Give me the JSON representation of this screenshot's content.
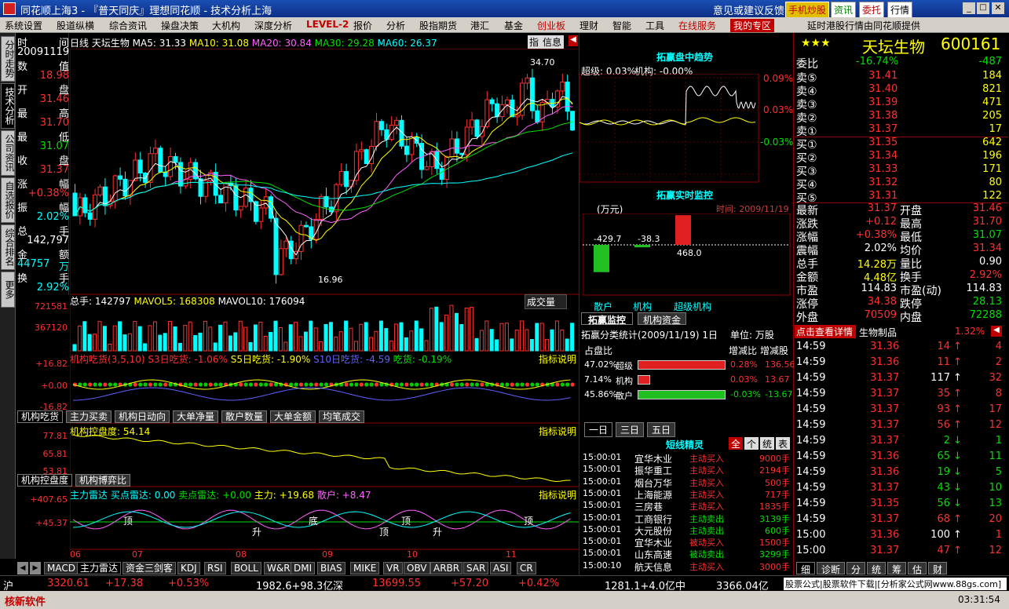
{
  "window": {
    "title": "同花顺上海3 - 『普天同庆』理想同花顺 - 技术分析上海",
    "feedback": "意见或建议反馈",
    "right_btns": [
      "手机炒股",
      "资讯",
      "委托",
      "行情"
    ]
  },
  "menu": [
    "系统设置",
    "股道纵横",
    "综合资讯",
    "操盘决策",
    "大机构",
    "深度分析",
    "LEVEL-2",
    "报价",
    "分析",
    "股指期货",
    "港汇",
    "基金",
    "创业板",
    "理财",
    "智能",
    "工具",
    "在线服务",
    "我的专区"
  ],
  "menu_notice": "延时港股行情由同花顺提供",
  "left_tabs": [
    "分时走势",
    "技术分析",
    "公司资讯",
    "自选报价",
    "综合排名",
    "更多"
  ],
  "info": [
    [
      "时",
      "间"
    ],
    [
      "20091119",
      ""
    ],
    [
      "数",
      "值"
    ],
    [
      "",
      "18.98"
    ],
    [
      "开",
      "盘"
    ],
    [
      "",
      "31.46"
    ],
    [
      "最",
      "高"
    ],
    [
      "",
      "31.70"
    ],
    [
      "最",
      "低"
    ],
    [
      "",
      "31.07"
    ],
    [
      "收",
      "盘"
    ],
    [
      "",
      "31.37"
    ],
    [
      "涨",
      "幅"
    ],
    [
      "",
      "+0.38%"
    ],
    [
      "振",
      "幅"
    ],
    [
      "",
      "2.02%"
    ],
    [
      "总",
      "手"
    ],
    [
      "",
      "142,797"
    ],
    [
      "金",
      "额"
    ],
    [
      "44757",
      "万"
    ],
    [
      "换",
      "手"
    ],
    [
      "",
      "2.92%"
    ]
  ],
  "kline": {
    "header": "日线  天坛生物",
    "ma5": "MA5: 31.33",
    "ma10": "MA10: 31.08",
    "ma20": "MA20: 30.84",
    "ma30": "MA30: 29.28",
    "ma60": "MA60: 26.37",
    "high_label": "34.70",
    "low_label": "16.96",
    "buttons": [
      "指",
      "信息"
    ]
  },
  "volume": {
    "header": "总手: 142797",
    "mavol5": "MAVOL5: 168308",
    "mavol10": "MAVOL10: 176094",
    "selector": "成交量",
    "ticks": [
      "721581",
      "367120"
    ]
  },
  "ind1": {
    "title": "机构吃货(3,5,10)",
    "s3": "S3日吃货: -1.06%",
    "s5": "S5日吃货: -1.90%",
    "s10": "S10日吃货: -4.59",
    "eat": "吃货: -0.19%",
    "explain": "指标说明",
    "ticks": [
      "+16.82",
      "+0.00",
      "-16.82"
    ]
  },
  "ind1_tabs": [
    "机构吃货",
    "主力买卖",
    "机构日动向",
    "大单净量",
    "散户数量",
    "大单金额",
    "均笔成交"
  ],
  "ind2": {
    "title": "机构控盘度: 54.14",
    "explain": "指标说明",
    "ticks": [
      "77.81",
      "65.81",
      "53.81"
    ]
  },
  "ind2_tabs": [
    "机构控盘度",
    "机构博弈比"
  ],
  "ind3": {
    "title": "主力雷达",
    "buy": "买点雷达: 0.00",
    "sell": "卖点雷达: +0.00",
    "main": "主力: +19.68",
    "retail": "散户: +8.47",
    "explain": "指标说明",
    "ticks": [
      "+407.65",
      "+45.37"
    ],
    "marks": [
      "顶",
      "升",
      "底",
      "顶",
      "顶",
      "升",
      "顶"
    ]
  },
  "x_axis": [
    "06",
    "07",
    "08",
    "09",
    "10",
    "11"
  ],
  "bottom_ind_tabs": [
    "MACD",
    "主力雷达",
    "资金三剑客",
    "KDJ",
    "RSI",
    "BOLL",
    "W&R",
    "DMI",
    "BIAS",
    "MIKE",
    "VR",
    "OBV",
    "ARBR",
    "SAR",
    "ASI",
    "CR"
  ],
  "mid": {
    "trend_title": "拓赢盘中趋势",
    "super": "超级: 0.03%",
    "inst": "机构: -0.00%",
    "trend_ticks": [
      "0.09%",
      "0.03%",
      "-0.03%"
    ],
    "rt_title": "拓赢实时监控",
    "unit": "(万元)",
    "time": "时间: 2009/11/19",
    "bar_labels": [
      "-429.7",
      "-38.3",
      "468.0"
    ],
    "bar_names": [
      "散户",
      "机构",
      "超级机构"
    ],
    "tabs": [
      "拓赢监控",
      "机构资金"
    ],
    "stat_title": "拓赢分类统计(2009/11/19) 1日",
    "stat_unit": "单位: 万股",
    "stat_headers": [
      "占盘比",
      "增减比",
      "增减股"
    ],
    "stat_rows": [
      [
        "47.02%",
        "超级",
        "0.28%",
        "136.56"
      ],
      [
        "7.14%",
        "机构",
        "0.03%",
        "13.67"
      ],
      [
        "45.86%",
        "散户",
        "-0.03%",
        "-13.67"
      ]
    ],
    "period_tabs": [
      "一日",
      "三日",
      "五日"
    ],
    "elf_title": "短线精灵",
    "elf_btns": [
      "全",
      "个",
      "统",
      "表"
    ],
    "elf_rows": [
      [
        "15:00:01",
        "宜华木业",
        "主动买入",
        "9000手"
      ],
      [
        "15:00:01",
        "振华重工",
        "主动买入",
        "2194手"
      ],
      [
        "15:00:01",
        "烟台万华",
        "主动买入",
        "500手"
      ],
      [
        "15:00:01",
        "上海能源",
        "主动买入",
        "717手"
      ],
      [
        "15:00:01",
        "三房巷",
        "主动买入",
        "1835手"
      ],
      [
        "15:00:01",
        "工商银行",
        "主动卖出",
        "3139手"
      ],
      [
        "15:00:01",
        "大元股份",
        "主动卖出",
        "600手"
      ],
      [
        "15:00:01",
        "宜华木业",
        "被动买入",
        "1500手"
      ],
      [
        "15:00:01",
        "山东高速",
        "被动卖出",
        "3299手"
      ],
      [
        "15:00:10",
        "航天信息",
        "主动买入",
        "3000手"
      ]
    ]
  },
  "quote": {
    "stars": "★★★",
    "name": "天坛生物",
    "code": "600161",
    "wb": [
      "委比",
      "-16.74%",
      "-487"
    ],
    "asks": [
      [
        "卖⑤",
        "31.41",
        "184"
      ],
      [
        "卖④",
        "31.40",
        "821"
      ],
      [
        "卖③",
        "31.39",
        "471"
      ],
      [
        "卖②",
        "31.38",
        "205"
      ],
      [
        "卖①",
        "31.37",
        "17"
      ]
    ],
    "bids": [
      [
        "买①",
        "31.35",
        "642"
      ],
      [
        "买②",
        "31.34",
        "196"
      ],
      [
        "买③",
        "31.33",
        "171"
      ],
      [
        "买④",
        "31.32",
        "80"
      ],
      [
        "买⑤",
        "31.31",
        "122"
      ]
    ],
    "stats": [
      [
        "最新",
        "31.37",
        "开盘",
        "31.46"
      ],
      [
        "涨跌",
        "+0.12",
        "最高",
        "31.70"
      ],
      [
        "涨幅",
        "+0.38%",
        "最低",
        "31.07"
      ],
      [
        "震幅",
        "2.02%",
        "均价",
        "31.34"
      ],
      [
        "总手",
        "14.28万",
        "量比",
        "0.90"
      ],
      [
        "金额",
        "4.48亿",
        "换手",
        "2.92%"
      ],
      [
        "市盈",
        "114.83",
        "市盈(动)",
        "114.83"
      ],
      [
        "涨停",
        "34.38",
        "跌停",
        "28.13"
      ],
      [
        "外盘",
        "70509",
        "内盘",
        "72288"
      ]
    ],
    "detail_btn": "点击查看详情",
    "sector": "生物制品",
    "sector_pct": "1.32%",
    "ticks": [
      [
        "14:59",
        "31.36",
        "14",
        "up",
        "4"
      ],
      [
        "14:59",
        "31.36",
        "11",
        "up",
        "2"
      ],
      [
        "14:59",
        "31.37",
        "117",
        "up",
        "32"
      ],
      [
        "14:59",
        "31.37",
        "35",
        "up",
        "8"
      ],
      [
        "14:59",
        "31.37",
        "93",
        "up",
        "17"
      ],
      [
        "14:59",
        "31.37",
        "56",
        "up",
        "12"
      ],
      [
        "14:59",
        "31.37",
        "2",
        "down",
        "1"
      ],
      [
        "14:59",
        "31.36",
        "65",
        "down",
        "11"
      ],
      [
        "14:59",
        "31.36",
        "19",
        "down",
        "5"
      ],
      [
        "14:59",
        "31.37",
        "43",
        "down",
        "10"
      ],
      [
        "14:59",
        "31.35",
        "56",
        "down",
        "13"
      ],
      [
        "14:59",
        "31.37",
        "68",
        "up",
        "20"
      ],
      [
        "15:00",
        "31.36",
        "100",
        "up",
        "1"
      ],
      [
        "15:00",
        "31.37",
        "47",
        "up",
        "12"
      ]
    ],
    "bottom_tabs": [
      "细",
      "诊断",
      "分",
      "统",
      "筹",
      "估",
      "财"
    ]
  },
  "status": {
    "sh": "沪",
    "sh_val": "3320.61",
    "sh_chg": "+17.38",
    "sh_pct": "+0.53%",
    "sh_amt": "1982.6+98.3亿",
    "sz": "深",
    "sz_val": "13699.55",
    "sz_chg": "+57.20",
    "sz_pct": "+0.42%",
    "sz_amt": "1281.1+4.0亿",
    "zx": "中",
    "zx_amt": "3366.04亿",
    "hint": "股票公式|股票软件下载|[分析家公式网www.88gs.com]"
  },
  "bottombar": {
    "app": "核新软件",
    "time": "03:31:54"
  }
}
